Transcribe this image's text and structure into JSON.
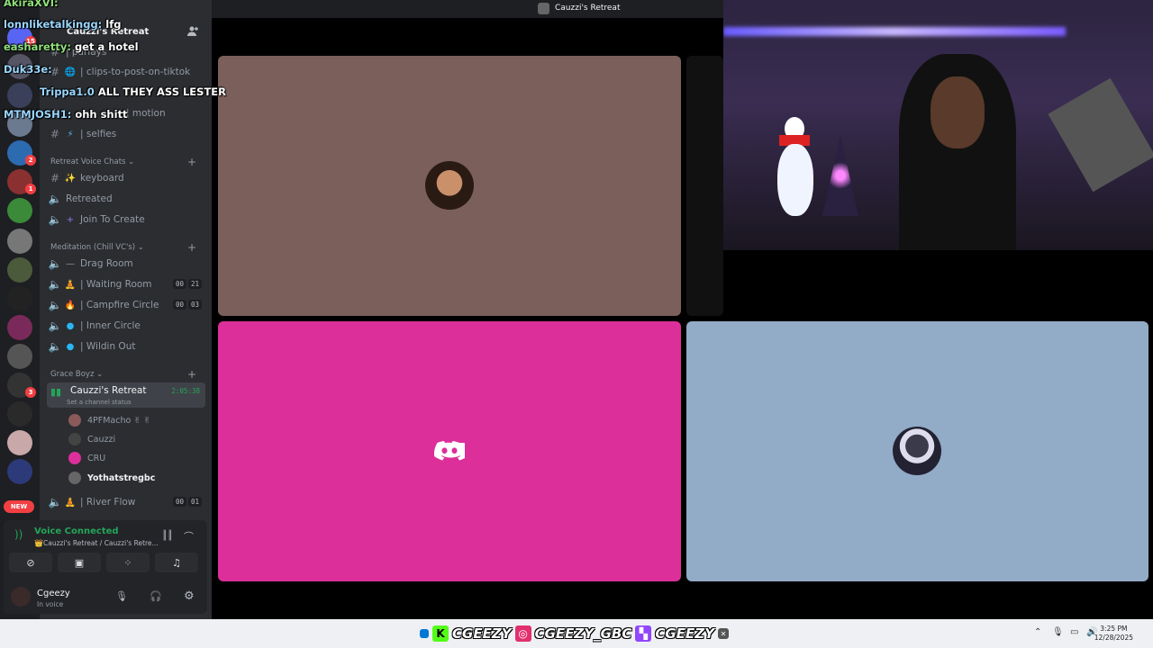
{
  "chat_overlay": [
    {
      "user": "AkiraXVI:",
      "msg": ""
    },
    {
      "user": "lonnliketalkingg:",
      "msg": "lfg"
    },
    {
      "user": "easharetty:",
      "msg": "get a hotel"
    },
    {
      "user": "Duk33e:",
      "msg": ""
    },
    {
      "user": "Trippa1.0",
      "msg": "ALL THEY ASS LESTER"
    },
    {
      "user": "MTMJOSH1:",
      "msg": "ohh shitt"
    }
  ],
  "server": {
    "name": "Cauzzi's Retreat"
  },
  "channels_top": [
    {
      "icon": "#",
      "label": "| parlays"
    },
    {
      "icon": "#",
      "label": "| clips-to-post-on-tiktok"
    },
    {
      "icon": "#",
      "label": "| motion"
    },
    {
      "icon": "#",
      "label": "| selfies"
    }
  ],
  "categories": {
    "voice": "Retreat Voice Chats",
    "meditation": "Meditation (Chill VC's)",
    "grace": "Grace Boyz"
  },
  "voice_channels": [
    {
      "icon": "#",
      "label": "keyboard"
    },
    {
      "icon": "speaker",
      "label": "Retreated"
    },
    {
      "icon": "speaker",
      "label": "Join To Create"
    }
  ],
  "meditation_channels": [
    {
      "label": "Drag Room",
      "counts": []
    },
    {
      "label": "| Waiting Room",
      "counts": [
        "00",
        "21"
      ]
    },
    {
      "label": "| Campfire Circle",
      "counts": [
        "00",
        "03"
      ]
    },
    {
      "label": "| Inner Circle",
      "counts": []
    },
    {
      "label": "| Wildin Out",
      "counts": []
    }
  ],
  "active_channel": {
    "label": "Cauzzi's Retreat",
    "time": "2:05:38",
    "status": "Set a channel status"
  },
  "members": [
    "4PFMacho ✌ ✌",
    "Cauzzi",
    "CRU",
    "Yothatstregbc"
  ],
  "river_flow": {
    "label": "| River Flow",
    "counts": [
      "00",
      "01"
    ]
  },
  "rail_badges": [
    "15",
    "2",
    "1",
    "3"
  ],
  "rail_new": "NEW",
  "voice_panel": {
    "title": "Voice Connected",
    "subtitle": "Cauzzi's Retreat / Cauzzi's Retre..."
  },
  "user": {
    "name": "Cgeezy",
    "status": "In voice"
  },
  "call_title": "Cauzzi's Retreat",
  "banner": {
    "handle1": "CGEEZY",
    "handle2": "CGEEZY_GBC",
    "handle3": "CGEEZY"
  },
  "clock": {
    "time": "3:25 PM",
    "date": "12/28/2025"
  },
  "colors": {
    "tile1": "#7b5f5a",
    "tile2": "#dc2f9a",
    "tile3": "#92abc6",
    "discord": "#5865f2",
    "online": "#23a559"
  }
}
